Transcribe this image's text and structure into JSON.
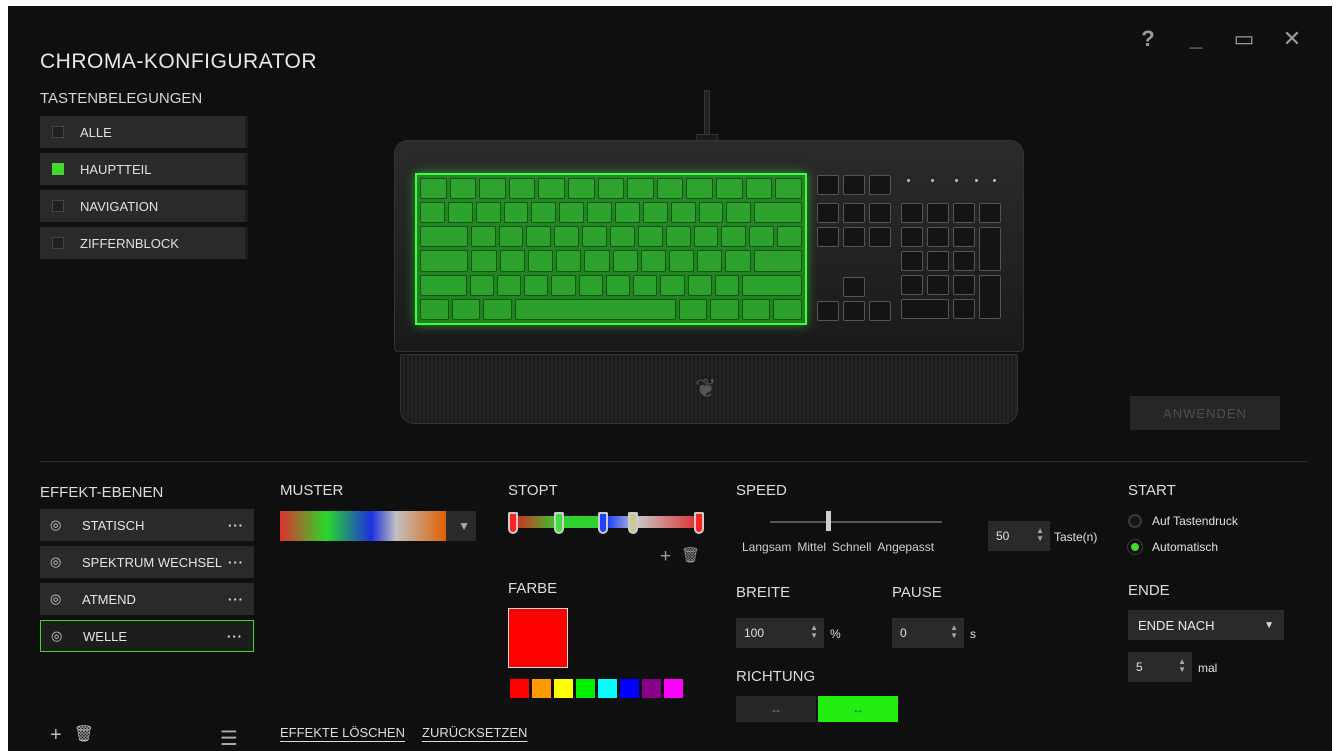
{
  "window": {
    "help_icon": "?",
    "minimize_icon": "_",
    "maximize_icon": "▭",
    "close_icon": "✕"
  },
  "header": {
    "title": "CHROMA-KONFIGURATOR",
    "key_groups_title": "TASTENBELEGUNGEN"
  },
  "key_groups": [
    {
      "label": "ALLE",
      "checked": false
    },
    {
      "label": "HAUPTTEIL",
      "checked": true
    },
    {
      "label": "NAVIGATION",
      "checked": false
    },
    {
      "label": "ZIFFERNBLOCK",
      "checked": false
    }
  ],
  "apply_label": "ANWENDEN",
  "effects": {
    "title": "EFFEKT-EBENEN",
    "layers": [
      {
        "label": "STATISCH",
        "selected": false
      },
      {
        "label": "SPEKTRUM WECHSEL",
        "selected": false
      },
      {
        "label": "ATMEND",
        "selected": false
      },
      {
        "label": "WELLE",
        "selected": true
      }
    ],
    "more_icon": "···",
    "eye_icon": "◎",
    "add_icon": "+",
    "delete_icon": "🗑",
    "menu_icon": "☰",
    "clear_label": "EFFEKTE LÖSCHEN",
    "reset_label": "ZURÜCKSETZEN"
  },
  "pattern": {
    "title": "MUSTER",
    "arrow_icon": "▼"
  },
  "stops": {
    "title": "STOPT",
    "colors": [
      "#ff2020",
      "#40e040",
      "#2040ff",
      "#c8c890",
      "#ff2020"
    ],
    "add_icon": "+",
    "delete_icon": "🗑"
  },
  "color": {
    "title": "FARBE",
    "current": "#ff0000",
    "swatches": [
      "#ff0000",
      "#ff9900",
      "#ffff00",
      "#00ee00",
      "#00ffff",
      "#0000ff",
      "#880088",
      "#ff00ff"
    ]
  },
  "speed": {
    "title": "SPEED",
    "labels": [
      "Langsam",
      "Mittel",
      "Schnell",
      "Angepasst"
    ],
    "value": "50",
    "unit": "Taste(n)"
  },
  "width": {
    "title": "BREITE",
    "value": "100",
    "unit": "%"
  },
  "pause": {
    "title": "PAUSE",
    "value": "0",
    "unit": "s"
  },
  "direction": {
    "title": "RICHTUNG",
    "left_icon": "↔",
    "right_icon": "↔",
    "active": "right"
  },
  "start": {
    "title": "START",
    "options": [
      {
        "label": "Auf Tastendruck",
        "selected": false
      },
      {
        "label": "Automatisch",
        "selected": true
      }
    ]
  },
  "end": {
    "title": "ENDE",
    "dropdown_value": "ENDE NACH",
    "caret_icon": "▼",
    "count_value": "5",
    "count_unit": "mal"
  },
  "accent_color": "#44d62c"
}
